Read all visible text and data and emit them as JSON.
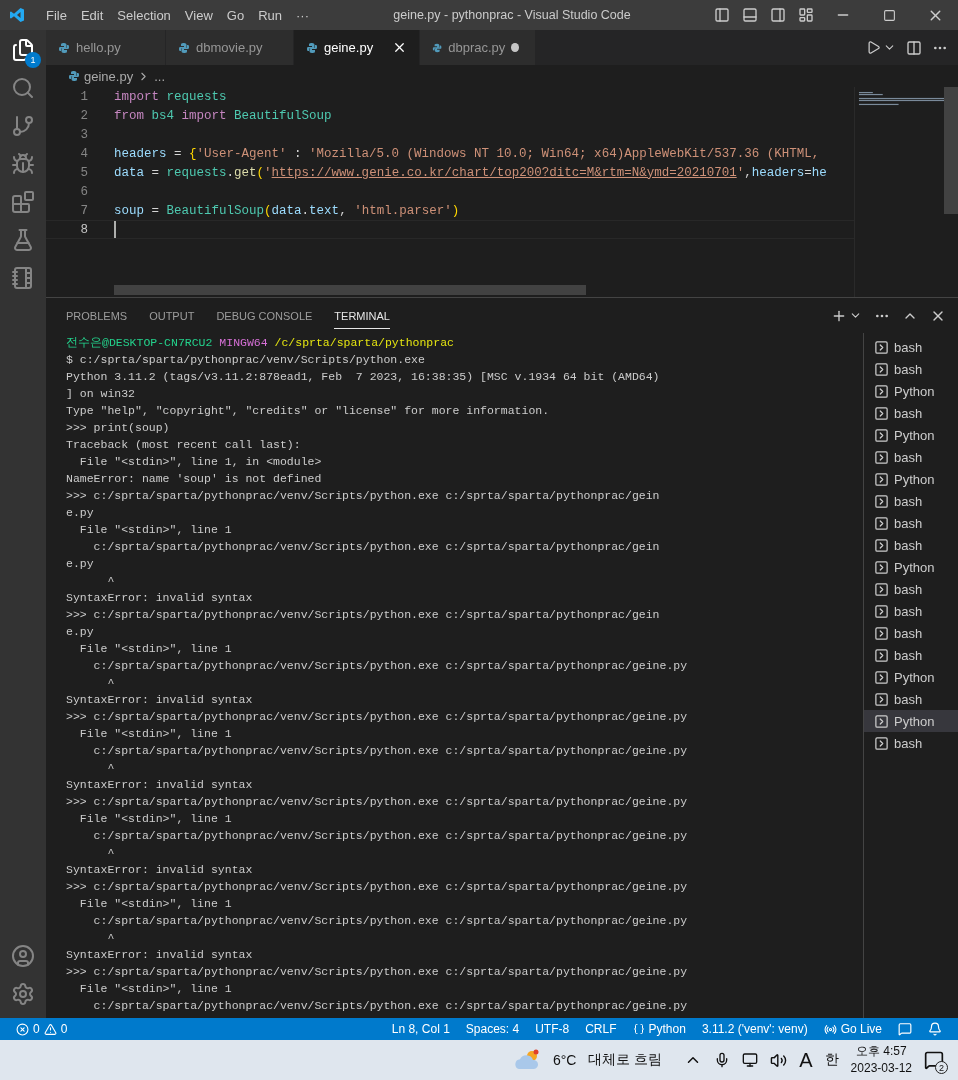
{
  "window": {
    "title": "geine.py - pythonprac - Visual Studio Code"
  },
  "menu": [
    "File",
    "Edit",
    "Selection",
    "View",
    "Go",
    "Run",
    "···"
  ],
  "activity_bar": {
    "explorer_badge": "1"
  },
  "tabs": [
    {
      "label": "hello.py",
      "selected": false,
      "modified": false
    },
    {
      "label": "dbmovie.py",
      "selected": false,
      "modified": false
    },
    {
      "label": "geine.py",
      "selected": true,
      "modified": false
    },
    {
      "label": "dbprac.py",
      "selected": false,
      "modified": true
    }
  ],
  "breadcrumb": {
    "file": "geine.py",
    "rest": "..."
  },
  "editor": {
    "lines": [
      {
        "number": "1",
        "active": false,
        "tokens": [
          {
            "kind": "keyword",
            "text": "import "
          },
          {
            "kind": "class",
            "text": "requests"
          }
        ]
      },
      {
        "number": "2",
        "active": false,
        "tokens": [
          {
            "kind": "keyword",
            "text": "from "
          },
          {
            "kind": "class",
            "text": "bs4 "
          },
          {
            "kind": "keyword",
            "text": "import "
          },
          {
            "kind": "class",
            "text": "BeautifulSoup"
          }
        ]
      },
      {
        "number": "3",
        "active": false
      },
      {
        "number": "4",
        "active": false,
        "tokens": [
          {
            "kind": "name",
            "text": "headers"
          },
          {
            "kind": "plain",
            "text": " = "
          },
          {
            "kind": "bracket",
            "text": "{"
          },
          {
            "kind": "string",
            "text": "'User-Agent'"
          },
          {
            "kind": "plain",
            "text": " : "
          },
          {
            "kind": "string",
            "text": "'Mozilla/5.0 (Windows NT 10.0; Win64; x64)AppleWebKit/537.36 (KHTML,"
          }
        ]
      },
      {
        "number": "5",
        "active": false,
        "tokens": [
          {
            "kind": "name",
            "text": "data"
          },
          {
            "kind": "plain",
            "text": " = "
          },
          {
            "kind": "class",
            "text": "requests"
          },
          {
            "kind": "plain",
            "text": "."
          },
          {
            "kind": "func",
            "text": "get"
          },
          {
            "kind": "bracket",
            "text": "("
          },
          {
            "kind": "string",
            "text": "'"
          },
          {
            "kind": "link",
            "text": "https://www.genie.co.kr/chart/top200?ditc=M&rtm=N&ymd=20210701"
          },
          {
            "kind": "string",
            "text": "'"
          },
          {
            "kind": "plain",
            "text": ","
          },
          {
            "kind": "name",
            "text": "headers"
          },
          {
            "kind": "plain",
            "text": "="
          },
          {
            "kind": "name",
            "text": "he"
          }
        ]
      },
      {
        "number": "6",
        "active": false
      },
      {
        "number": "7",
        "active": false,
        "tokens": [
          {
            "kind": "name",
            "text": "soup"
          },
          {
            "kind": "plain",
            "text": " = "
          },
          {
            "kind": "class",
            "text": "BeautifulSoup"
          },
          {
            "kind": "bracket",
            "text": "("
          },
          {
            "kind": "name",
            "text": "data"
          },
          {
            "kind": "plain",
            "text": "."
          },
          {
            "kind": "name",
            "text": "text"
          },
          {
            "kind": "plain",
            "text": ", "
          },
          {
            "kind": "string",
            "text": "'html.parser'"
          },
          {
            "kind": "bracket",
            "text": ")"
          }
        ]
      },
      {
        "number": "8",
        "active": true
      }
    ]
  },
  "panel": {
    "tabs": [
      {
        "label": "PROBLEMS",
        "selected": false
      },
      {
        "label": "OUTPUT",
        "selected": false
      },
      {
        "label": "DEBUG CONSOLE",
        "selected": false
      },
      {
        "label": "TERMINAL",
        "selected": true
      }
    ],
    "prompt": {
      "user": "전수은@DESKTOP-CN7RCU2",
      "shell": "MINGW64",
      "path": "/c/sprta/sparta/pythonprac"
    },
    "lines": [
      "$ c:/sprta/sparta/pythonprac/venv/Scripts/python.exe",
      "Python 3.11.2 (tags/v3.11.2:878ead1, Feb  7 2023, 16:38:35) [MSC v.1934 64 bit (AMD64)",
      "] on win32",
      "Type \"help\", \"copyright\", \"credits\" or \"license\" for more information.",
      ">>> print(soup)",
      "Traceback (most recent call last):",
      "  File \"<stdin>\", line 1, in <module>",
      "NameError: name 'soup' is not defined",
      ">>> c:/sprta/sparta/pythonprac/venv/Scripts/python.exe c:/sprta/sparta/pythonprac/gein",
      "e.py",
      "  File \"<stdin>\", line 1",
      "    c:/sprta/sparta/pythonprac/venv/Scripts/python.exe c:/sprta/sparta/pythonprac/gein",
      "e.py",
      "      ^",
      "SyntaxError: invalid syntax",
      ">>> c:/sprta/sparta/pythonprac/venv/Scripts/python.exe c:/sprta/sparta/pythonprac/gein",
      "e.py",
      "  File \"<stdin>\", line 1",
      "    c:/sprta/sparta/pythonprac/venv/Scripts/python.exe c:/sprta/sparta/pythonprac/geine.py",
      "      ^",
      "SyntaxError: invalid syntax",
      ">>> c:/sprta/sparta/pythonprac/venv/Scripts/python.exe c:/sprta/sparta/pythonprac/geine.py",
      "  File \"<stdin>\", line 1",
      "    c:/sprta/sparta/pythonprac/venv/Scripts/python.exe c:/sprta/sparta/pythonprac/geine.py",
      "      ^",
      "SyntaxError: invalid syntax",
      ">>> c:/sprta/sparta/pythonprac/venv/Scripts/python.exe c:/sprta/sparta/pythonprac/geine.py",
      "  File \"<stdin>\", line 1",
      "    c:/sprta/sparta/pythonprac/venv/Scripts/python.exe c:/sprta/sparta/pythonprac/geine.py",
      "      ^",
      "SyntaxError: invalid syntax",
      ">>> c:/sprta/sparta/pythonprac/venv/Scripts/python.exe c:/sprta/sparta/pythonprac/geine.py",
      "  File \"<stdin>\", line 1",
      "    c:/sprta/sparta/pythonprac/venv/Scripts/python.exe c:/sprta/sparta/pythonprac/geine.py",
      "      ^",
      "SyntaxError: invalid syntax",
      ">>> c:/sprta/sparta/pythonprac/venv/Scripts/python.exe c:/sprta/sparta/pythonprac/geine.py",
      "  File \"<stdin>\", line 1",
      "    c:/sprta/sparta/pythonprac/venv/Scripts/python.exe c:/sprta/sparta/pythonprac/geine.py"
    ],
    "terminals": [
      {
        "label": "bash",
        "selected": false
      },
      {
        "label": "bash",
        "selected": false
      },
      {
        "label": "Python",
        "selected": false
      },
      {
        "label": "bash",
        "selected": false
      },
      {
        "label": "Python",
        "selected": false
      },
      {
        "label": "bash",
        "selected": false
      },
      {
        "label": "Python",
        "selected": false
      },
      {
        "label": "bash",
        "selected": false
      },
      {
        "label": "bash",
        "selected": false
      },
      {
        "label": "bash",
        "selected": false
      },
      {
        "label": "Python",
        "selected": false
      },
      {
        "label": "bash",
        "selected": false
      },
      {
        "label": "bash",
        "selected": false
      },
      {
        "label": "bash",
        "selected": false
      },
      {
        "label": "bash",
        "selected": false
      },
      {
        "label": "Python",
        "selected": false
      },
      {
        "label": "bash",
        "selected": false
      },
      {
        "label": "Python",
        "selected": true
      },
      {
        "label": "bash",
        "selected": false
      }
    ]
  },
  "status_bar": {
    "errors": "0",
    "warnings": "0",
    "items": [
      "Ln 8, Col 1",
      "Spaces: 4",
      "UTF-8",
      "CRLF"
    ],
    "language": "Python",
    "interpreter": "3.11.2 ('venv': venv)",
    "live": "Go Live"
  },
  "taskbar": {
    "temperature": "6°C",
    "weather": "대체로 흐림",
    "keyboard": "A",
    "ime": "한",
    "time": "오후 4:57",
    "date": "2023-03-12",
    "notifications": "2"
  }
}
